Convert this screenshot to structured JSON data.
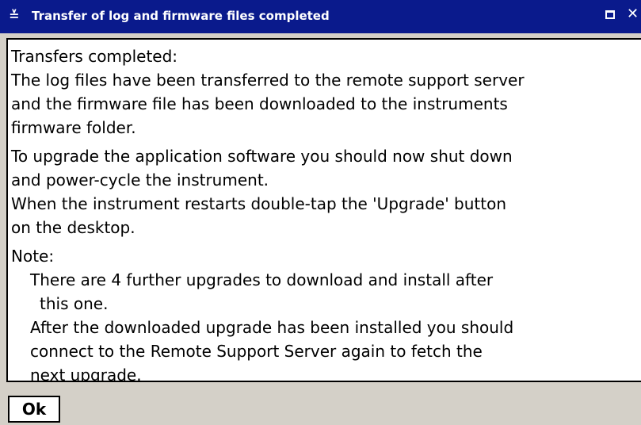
{
  "window": {
    "title": "Transfer of log and firmware files completed",
    "menu_icon": "window-menu-icon",
    "maximize_icon": "maximize-icon",
    "close_icon": "close-icon",
    "titlebar_color": "#0a1a8c"
  },
  "message": {
    "heading": "Transfers completed:",
    "para1_lines": [
      "The log files have been transferred to the remote support server",
      "and the firmware file has been downloaded to the instruments",
      "firmware folder."
    ],
    "para2_lines": [
      "To upgrade the application software you should now shut down",
      "and power-cycle the instrument.",
      "When the instrument restarts double-tap the 'Upgrade' button",
      "on the desktop."
    ],
    "note_label": "Note:",
    "note_lines": [
      "There are 4 further upgrades to download and install after",
      "this one.",
      "After the downloaded upgrade has been installed you should",
      "connect to the Remote Support Server again to fetch the",
      "next upgrade."
    ]
  },
  "buttons": {
    "ok_label": "Ok"
  }
}
